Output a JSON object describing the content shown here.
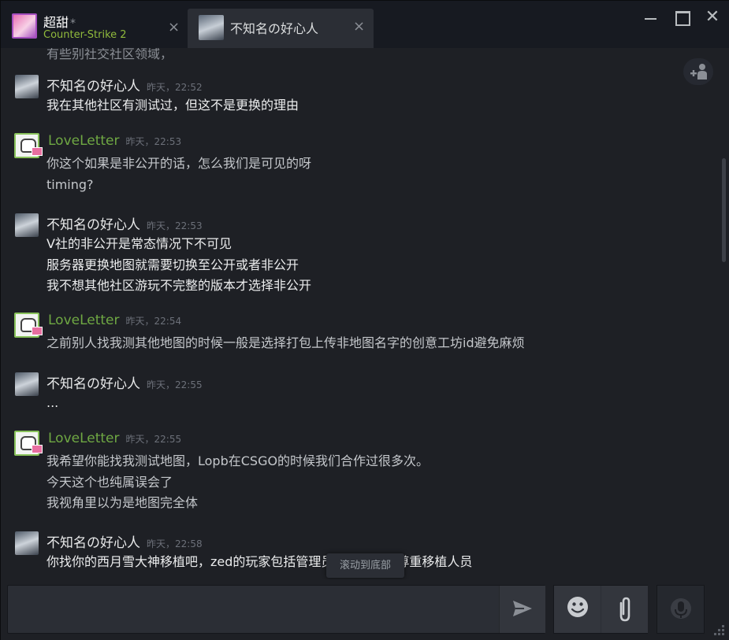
{
  "tabs": [
    {
      "name": "超甜",
      "star": "*",
      "game": "Counter-Strike 2",
      "close": "×"
    },
    {
      "name": "不知名の好心人",
      "close": "×"
    }
  ],
  "window": {
    "close": "✕"
  },
  "chat": {
    "cut_off_line": "有些别社交社区领域，",
    "messages": [
      {
        "sender": "不知名の好心人",
        "time": "昨天，22:52",
        "self": false,
        "lines": [
          "我在其他社区有测试过，但这不是更换的理由"
        ]
      },
      {
        "sender": "LoveLetter",
        "time": "昨天，22:53",
        "self": true,
        "lines": [
          "你这个如果是非公开的话，怎么我们是可见的呀",
          "timing?"
        ]
      },
      {
        "sender": "不知名の好心人",
        "time": "昨天，22:53",
        "self": false,
        "lines": [
          "V社的非公开是常态情况下不可见",
          "服务器更换地图就需要切换至公开或者非公开",
          "我不想其他社区游玩不完整的版本才选择非公开"
        ]
      },
      {
        "sender": "LoveLetter",
        "time": "昨天，22:54",
        "self": true,
        "lines": [
          "之前别人找我测其他地图的时候一般是选择打包上传非地图名字的创意工坊id避免麻烦"
        ]
      },
      {
        "sender": "不知名の好心人",
        "time": "昨天，22:55",
        "self": false,
        "lines": [
          "..."
        ]
      },
      {
        "sender": "LoveLetter",
        "time": "昨天，22:55",
        "self": true,
        "lines": [
          "我希望你能找我测试地图，Lopb在CSGO的时候我们合作过很多次。",
          "今天这个也纯属误会了",
          "我视角里以为是地图完全体"
        ]
      },
      {
        "sender": "不知名の好心人",
        "time": "昨天，22:58",
        "self": false,
        "lines": [
          "你找你的西月雪大神移植吧，zed的玩家包括管理员我都感到在尊重移植人员"
        ]
      }
    ]
  },
  "jump_to_bottom": "滚动到底部",
  "composer": {
    "placeholder": "",
    "value": ""
  },
  "icons": {
    "invite": "person-plus-icon",
    "send": "send-icon",
    "emoji": "emoji-icon",
    "attach": "paperclip-icon",
    "voice": "microphone-icon"
  },
  "colors": {
    "accent_green": "#90ba3c",
    "self_name": "#6fa843",
    "background": "#1e2025",
    "tabbar": "#171a21"
  }
}
